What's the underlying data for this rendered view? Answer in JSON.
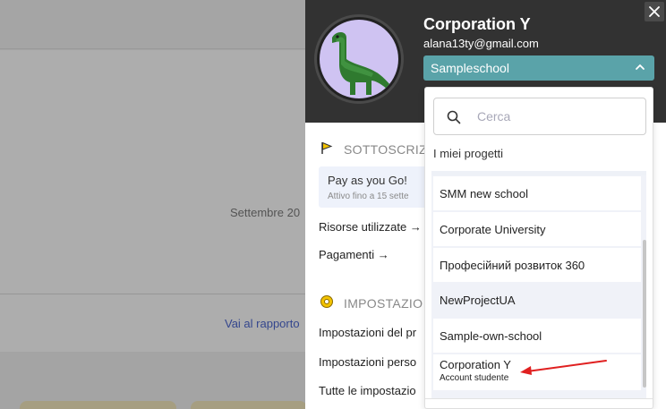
{
  "background": {
    "date_label": "Settembre 20",
    "report_link": "Vai al rapporto"
  },
  "panel": {
    "user_name": "Corporation Y",
    "user_email": "alana13ty@gmail.com",
    "school_selector": "Sampleschool",
    "subscription": {
      "title": "SOTTOSCRIZ",
      "plan": "Pay as you Go!",
      "active_until": "Attivo fino a 15 sette"
    },
    "links": {
      "resources_used": "Risorse utilizzate →",
      "payments": "Pagamenti →"
    },
    "settings": {
      "title": "IMPOSTAZIO",
      "items": [
        "Impostazioni del pr",
        "Impostazioni perso",
        "Tutte le impostazio"
      ]
    }
  },
  "dropdown": {
    "search_placeholder": "Cerca",
    "heading": "I miei progetti",
    "projects": [
      {
        "label": "SMM new school"
      },
      {
        "label": "Corporate University"
      },
      {
        "label": "Професійний розвиток 360"
      },
      {
        "label": "NewProjectUA"
      },
      {
        "label": "Sample-own-school"
      }
    ],
    "last_project": {
      "label": "Corporation Y",
      "sublabel": "Account studente"
    }
  },
  "colors": {
    "header_bg": "#323232",
    "accent_teal": "#5aa3a9",
    "flag_yellow": "#f2c200",
    "annotation_red": "#e02020",
    "dino_green": "#3f8f3f"
  }
}
